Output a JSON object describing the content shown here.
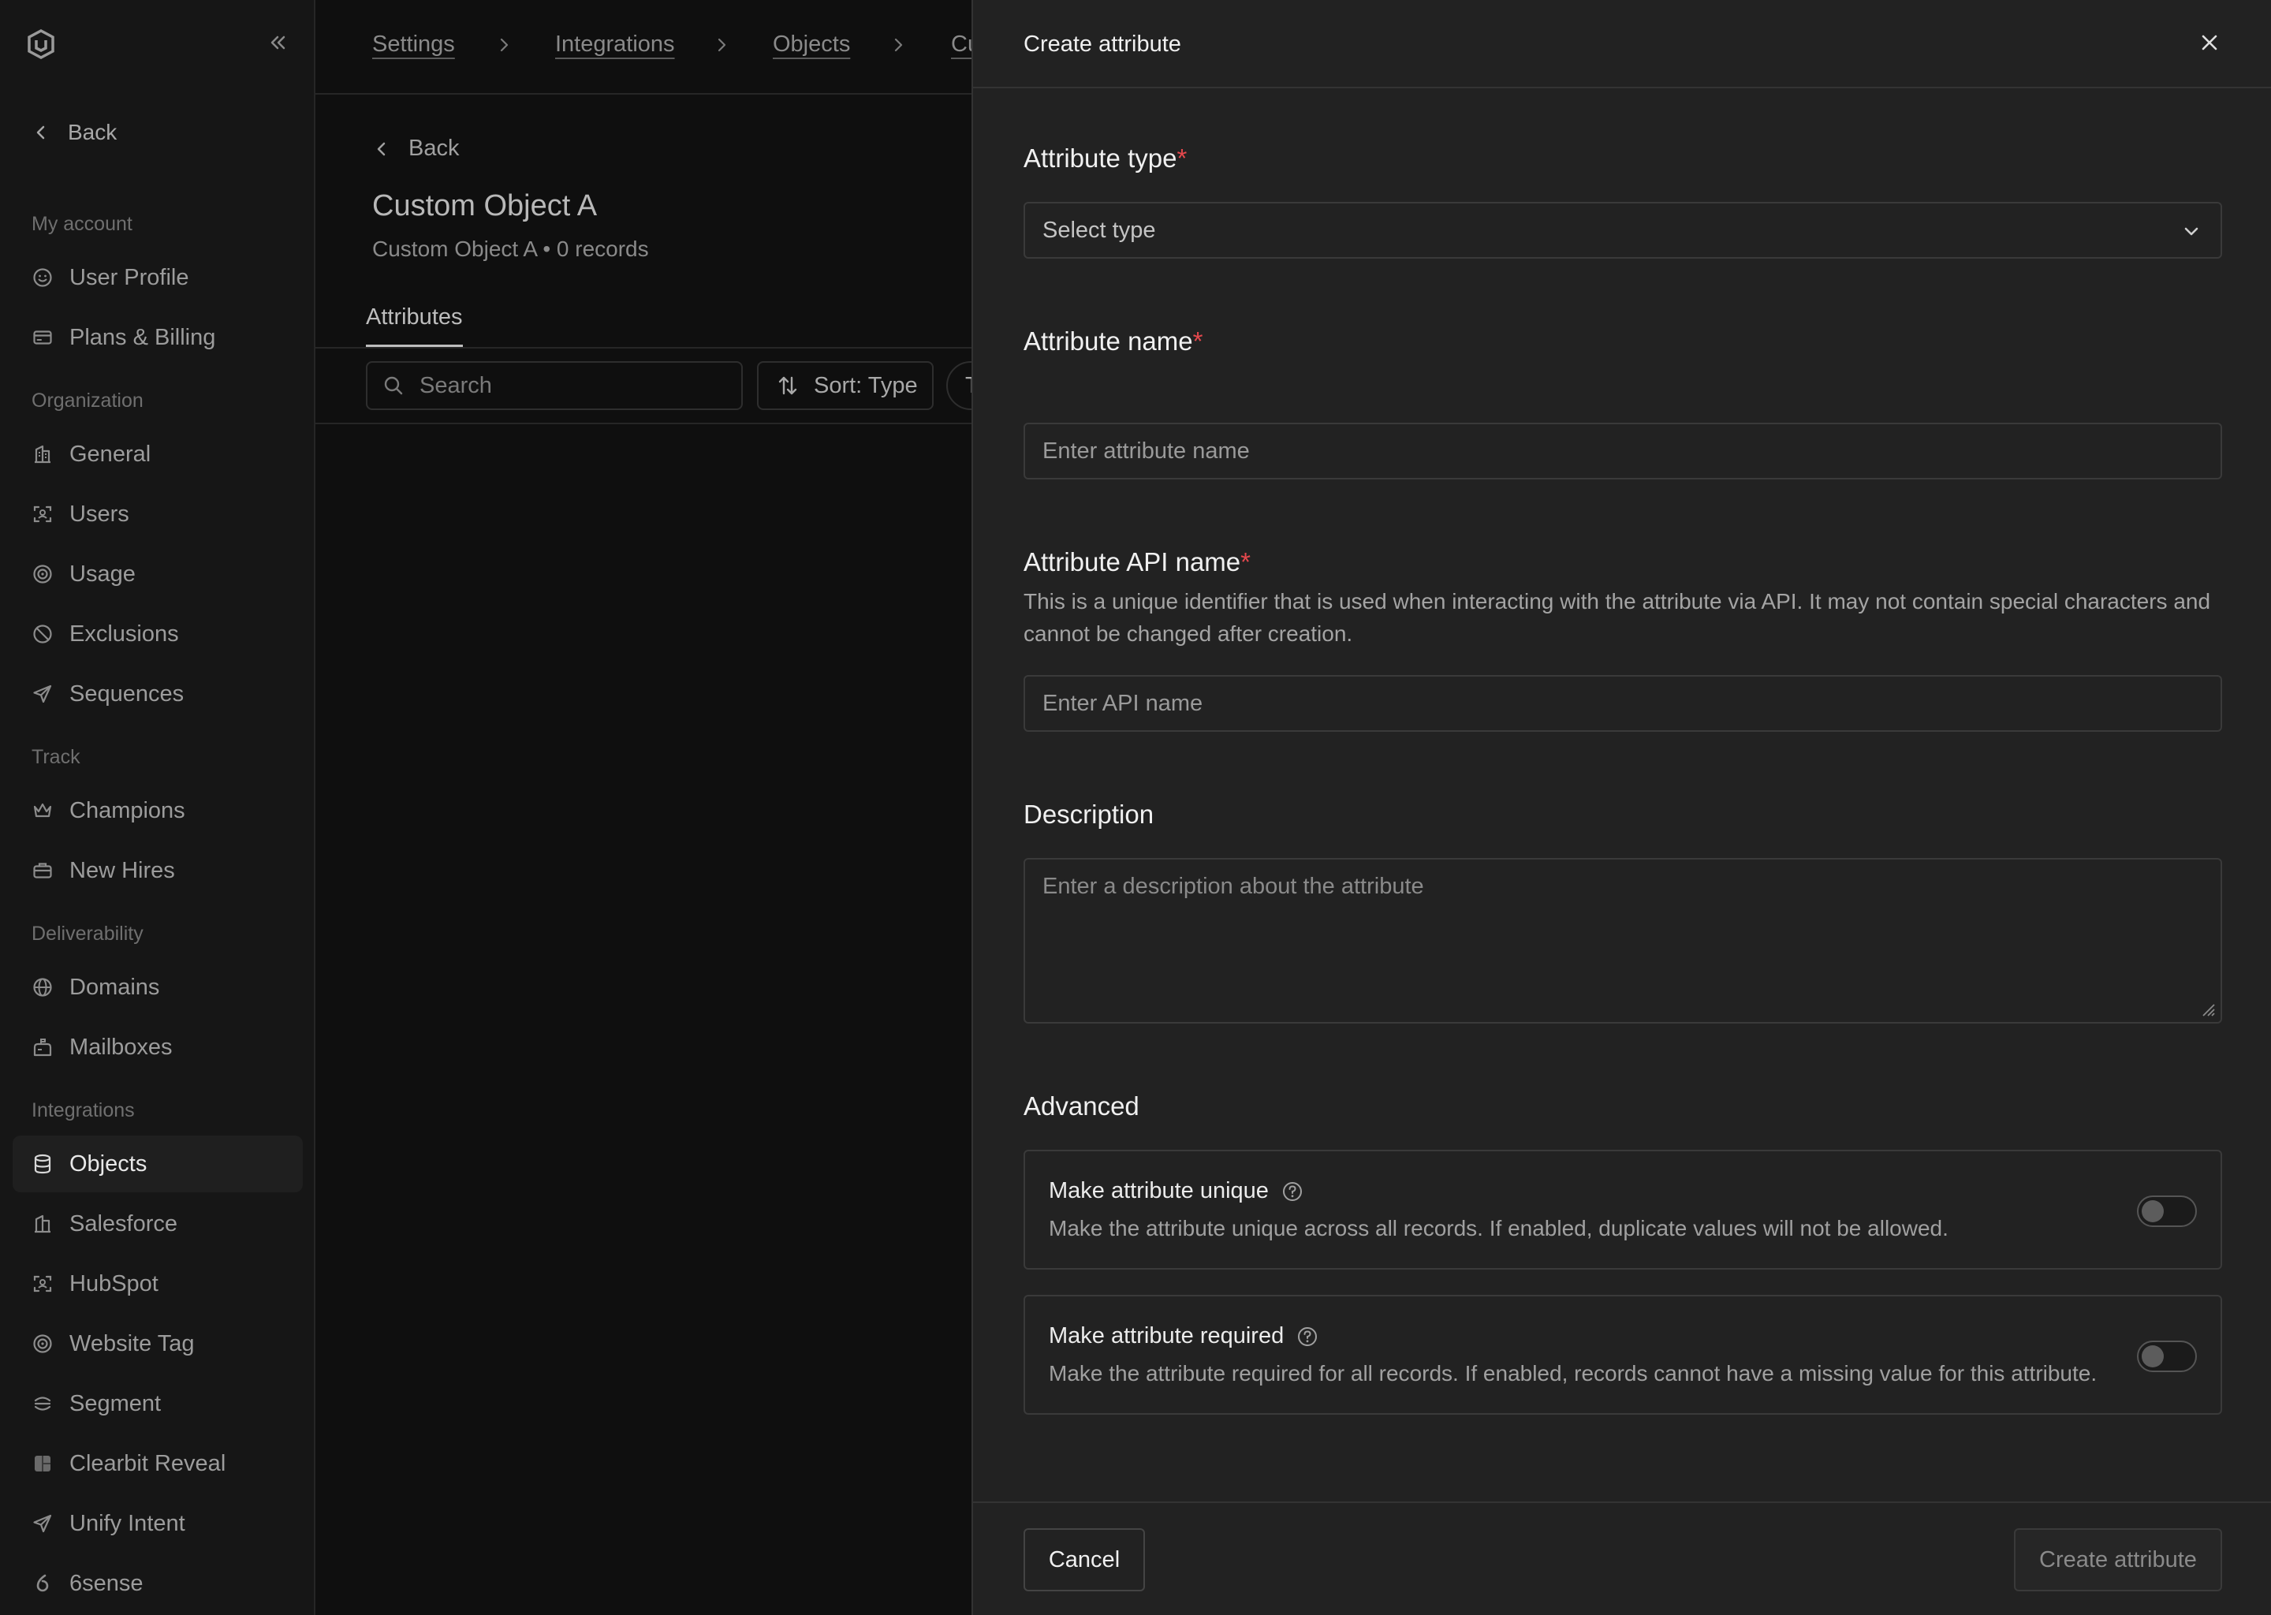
{
  "sidebar": {
    "back_label": "Back",
    "sections": {
      "my_account": "My account",
      "organization": "Organization",
      "track": "Track",
      "deliverability": "Deliverability",
      "integrations": "Integrations"
    },
    "items": {
      "user_profile": "User Profile",
      "plans_billing": "Plans & Billing",
      "general": "General",
      "users": "Users",
      "usage": "Usage",
      "exclusions": "Exclusions",
      "sequences": "Sequences",
      "champions": "Champions",
      "new_hires": "New Hires",
      "domains": "Domains",
      "mailboxes": "Mailboxes",
      "objects": "Objects",
      "salesforce": "Salesforce",
      "hubspot": "HubSpot",
      "website_tag": "Website Tag",
      "segment": "Segment",
      "clearbit_reveal": "Clearbit Reveal",
      "unify_intent": "Unify Intent",
      "sixsense": "6sense"
    },
    "active_item": "objects"
  },
  "breadcrumb": [
    "Settings",
    "Integrations",
    "Objects",
    "Cu"
  ],
  "main": {
    "back_label": "Back",
    "title": "Custom Object A",
    "subtitle": "Custom Object A • 0 records",
    "tab": "Attributes",
    "search_placeholder": "Search",
    "sort_label": "Sort: Type",
    "filter_label": "T"
  },
  "drawer": {
    "title": "Create attribute",
    "type_label": "Attribute type",
    "type_placeholder": "Select type",
    "name_label": "Attribute name",
    "name_placeholder": "Enter attribute name",
    "api_label": "Attribute API name",
    "api_help": "This is a unique identifier that is used when interacting with the attribute via API. It may not contain special characters and cannot be changed after creation.",
    "api_placeholder": "Enter API name",
    "description_label": "Description",
    "description_placeholder": "Enter a description about the attribute",
    "advanced_label": "Advanced",
    "unique_title": "Make attribute unique",
    "unique_desc": "Make the attribute unique across all records. If enabled, duplicate values will not be allowed.",
    "unique_enabled": false,
    "required_title": "Make attribute required",
    "required_desc": "Make the attribute required for all records. If enabled, records cannot have a missing value for this attribute.",
    "required_enabled": false,
    "required_marker": "*",
    "cancel_label": "Cancel",
    "create_label": "Create attribute"
  },
  "colors": {
    "required_marker": "#e5484d",
    "drawer_bg": "#222222",
    "sidebar_bg": "#161616"
  }
}
